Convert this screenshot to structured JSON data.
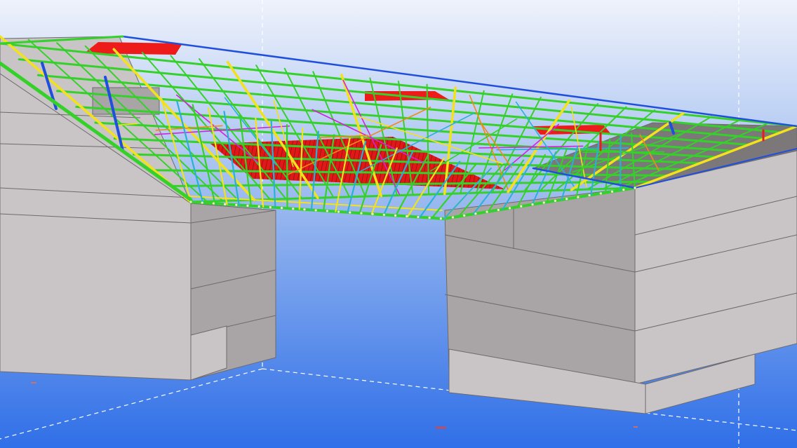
{
  "view": {
    "type": "3d-structural-model-viewport",
    "background": {
      "top": "#eef2fb",
      "mid": "#9ab9ef",
      "bottom": "#2f6fe8"
    },
    "colors": {
      "concrete_light": "#c9c4c6",
      "concrete_mid": "#a9a4a6",
      "concrete_dark": "#7b7677",
      "slab_top": "#7c7778",
      "member_green": "#35d12a",
      "member_blue": "#1f4fdc",
      "member_red": "#ee1b1b",
      "member_yellow": "#f2e21d",
      "member_cyan": "#2ab0d8",
      "member_magenta": "#d224d8",
      "member_orange": "#f08a1a",
      "grid_line": "#ffffff"
    }
  }
}
